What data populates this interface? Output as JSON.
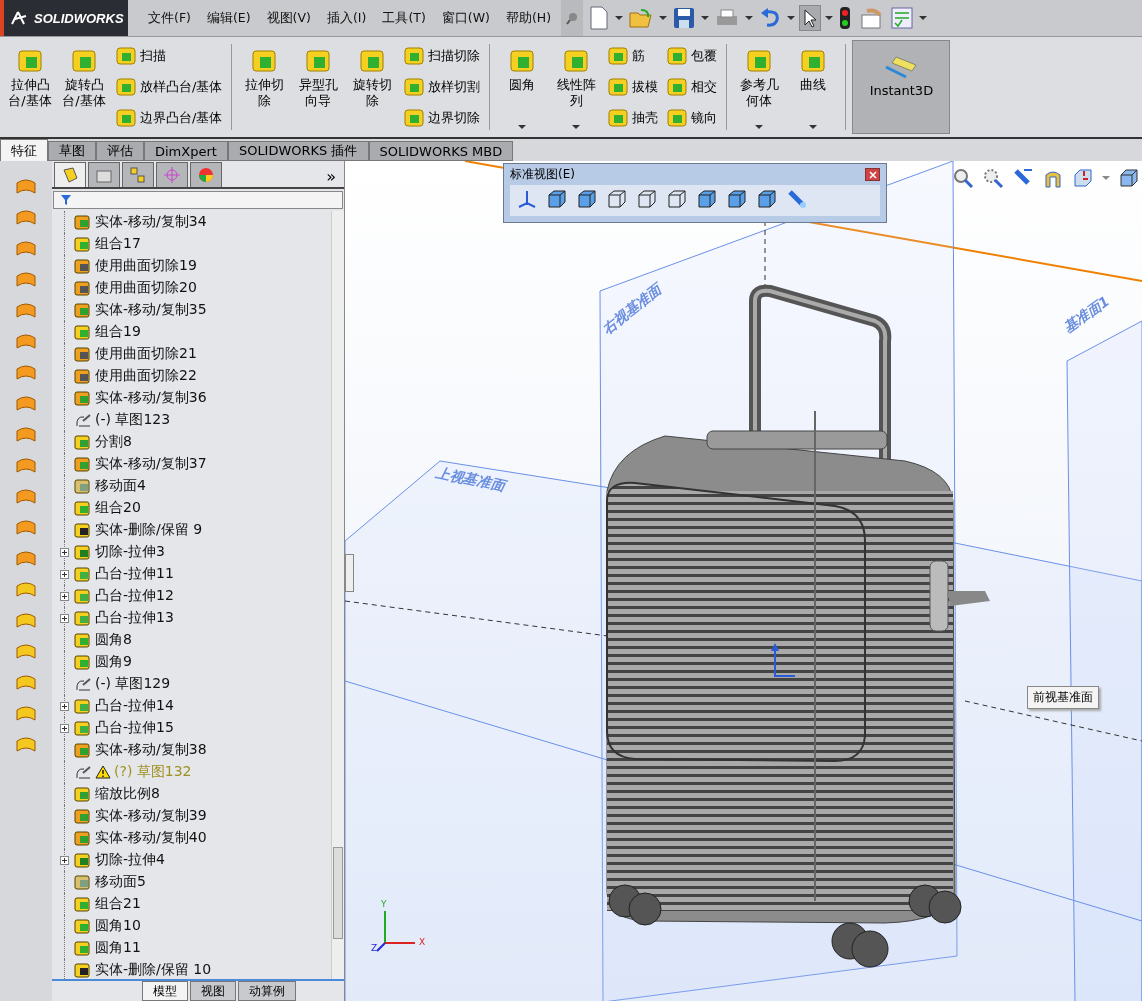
{
  "app": {
    "logo": "SOLIDWORKS"
  },
  "menu": [
    "文件(F)",
    "编辑(E)",
    "视图(V)",
    "插入(I)",
    "工具(T)",
    "窗口(W)",
    "帮助(H)"
  ],
  "ribbon": [
    {
      "kind": "large",
      "label": "拉伸凸台/基体",
      "dropdown": false,
      "selected": false
    },
    {
      "kind": "large",
      "label": "旋转凸台/基体",
      "dropdown": false,
      "selected": false
    },
    {
      "kind": "stack",
      "items": [
        "扫描",
        "放样凸台/基体",
        "边界凸台/基体"
      ]
    },
    {
      "kind": "separator"
    },
    {
      "kind": "large",
      "label": "拉伸切除",
      "dropdown": false,
      "selected": false
    },
    {
      "kind": "large",
      "label": "异型孔向导",
      "dropdown": false,
      "selected": false
    },
    {
      "kind": "large",
      "label": "旋转切除",
      "dropdown": false,
      "selected": false
    },
    {
      "kind": "stack",
      "items": [
        "扫描切除",
        "放样切割",
        "边界切除"
      ]
    },
    {
      "kind": "separator"
    },
    {
      "kind": "large",
      "label": "圆角",
      "dropdown": true,
      "selected": false
    },
    {
      "kind": "large",
      "label": "线性阵列",
      "dropdown": true,
      "selected": false
    },
    {
      "kind": "stack",
      "items": [
        "筋",
        "拔模",
        "抽壳"
      ]
    },
    {
      "kind": "stack",
      "items": [
        "包覆",
        "相交",
        "镜向"
      ]
    },
    {
      "kind": "separator"
    },
    {
      "kind": "large",
      "label": "参考几何体",
      "dropdown": true,
      "selected": false
    },
    {
      "kind": "large",
      "label": "曲线",
      "dropdown": true,
      "selected": false
    },
    {
      "kind": "separator"
    },
    {
      "kind": "large",
      "label": "Instant3D",
      "dropdown": false,
      "selected": true
    }
  ],
  "tabs": [
    {
      "label": "特征",
      "selected": true
    },
    {
      "label": "草图",
      "selected": false
    },
    {
      "label": "评估",
      "selected": false
    },
    {
      "label": "DimXpert",
      "selected": false
    },
    {
      "label": "SOLIDWORKS 插件",
      "selected": false
    },
    {
      "label": "SOLIDWORKS MBD",
      "selected": false
    }
  ],
  "panel": {
    "more": "»"
  },
  "tree": [
    {
      "label": "实体-移动/复制34",
      "kind": "move",
      "expandable": false,
      "warning": false
    },
    {
      "label": "组合17",
      "kind": "combine",
      "expandable": false,
      "warning": false
    },
    {
      "label": "使用曲面切除19",
      "kind": "surfcut",
      "expandable": false,
      "warning": false
    },
    {
      "label": "使用曲面切除20",
      "kind": "surfcut",
      "expandable": false,
      "warning": false
    },
    {
      "label": "实体-移动/复制35",
      "kind": "move",
      "expandable": false,
      "warning": false
    },
    {
      "label": "组合19",
      "kind": "combine",
      "expandable": false,
      "warning": false
    },
    {
      "label": "使用曲面切除21",
      "kind": "surfcut",
      "expandable": false,
      "warning": false
    },
    {
      "label": "使用曲面切除22",
      "kind": "surfcut",
      "expandable": false,
      "warning": false
    },
    {
      "label": "实体-移动/复制36",
      "kind": "move",
      "expandable": false,
      "warning": false
    },
    {
      "label": "(-) 草图123",
      "kind": "sketch",
      "expandable": false,
      "warning": false
    },
    {
      "label": "分割8",
      "kind": "split",
      "expandable": false,
      "warning": false
    },
    {
      "label": "实体-移动/复制37",
      "kind": "move",
      "expandable": false,
      "warning": false
    },
    {
      "label": "移动面4",
      "kind": "moveface",
      "expandable": false,
      "warning": false
    },
    {
      "label": "组合20",
      "kind": "combine",
      "expandable": false,
      "warning": false
    },
    {
      "label": "实体-删除/保留 9",
      "kind": "delete",
      "expandable": false,
      "warning": false
    },
    {
      "label": "切除-拉伸3",
      "kind": "cut",
      "expandable": true,
      "warning": false
    },
    {
      "label": "凸台-拉伸11",
      "kind": "boss",
      "expandable": true,
      "warning": false
    },
    {
      "label": "凸台-拉伸12",
      "kind": "boss",
      "expandable": true,
      "warning": false
    },
    {
      "label": "凸台-拉伸13",
      "kind": "boss",
      "expandable": true,
      "warning": false
    },
    {
      "label": "圆角8",
      "kind": "fillet",
      "expandable": false,
      "warning": false
    },
    {
      "label": "圆角9",
      "kind": "fillet",
      "expandable": false,
      "warning": false
    },
    {
      "label": "(-) 草图129",
      "kind": "sketch",
      "expandable": false,
      "warning": false
    },
    {
      "label": "凸台-拉伸14",
      "kind": "boss",
      "expandable": true,
      "warning": false
    },
    {
      "label": "凸台-拉伸15",
      "kind": "boss",
      "expandable": true,
      "warning": false
    },
    {
      "label": "实体-移动/复制38",
      "kind": "move",
      "expandable": false,
      "warning": false
    },
    {
      "label": "(?) 草图132",
      "kind": "sketch",
      "expandable": false,
      "warning": true
    },
    {
      "label": "缩放比例8",
      "kind": "scale",
      "expandable": false,
      "warning": false
    },
    {
      "label": "实体-移动/复制39",
      "kind": "move",
      "expandable": false,
      "warning": false
    },
    {
      "label": "实体-移动/复制40",
      "kind": "move",
      "expandable": false,
      "warning": false
    },
    {
      "label": "切除-拉伸4",
      "kind": "cut",
      "expandable": true,
      "warning": false
    },
    {
      "label": "移动面5",
      "kind": "moveface",
      "expandable": false,
      "warning": false
    },
    {
      "label": "组合21",
      "kind": "combine",
      "expandable": false,
      "warning": false
    },
    {
      "label": "圆角10",
      "kind": "fillet",
      "expandable": false,
      "warning": false
    },
    {
      "label": "圆角11",
      "kind": "fillet",
      "expandable": false,
      "warning": false
    },
    {
      "label": "实体-删除/保留 10",
      "kind": "delete",
      "expandable": false,
      "warning": false
    }
  ],
  "bottom_tabs": [
    {
      "label": "模型",
      "selected": true
    },
    {
      "label": "视图",
      "selected": false
    },
    {
      "label": "动算例",
      "selected": false
    }
  ],
  "viewport": {
    "view_toolbar": {
      "title": "标准视图(E)"
    },
    "plane_labels": [
      "右视基准面",
      "上视基准面",
      "基准面1"
    ],
    "tooltip": "前视基准面",
    "triad": [
      "Y",
      "X",
      "Z"
    ]
  }
}
